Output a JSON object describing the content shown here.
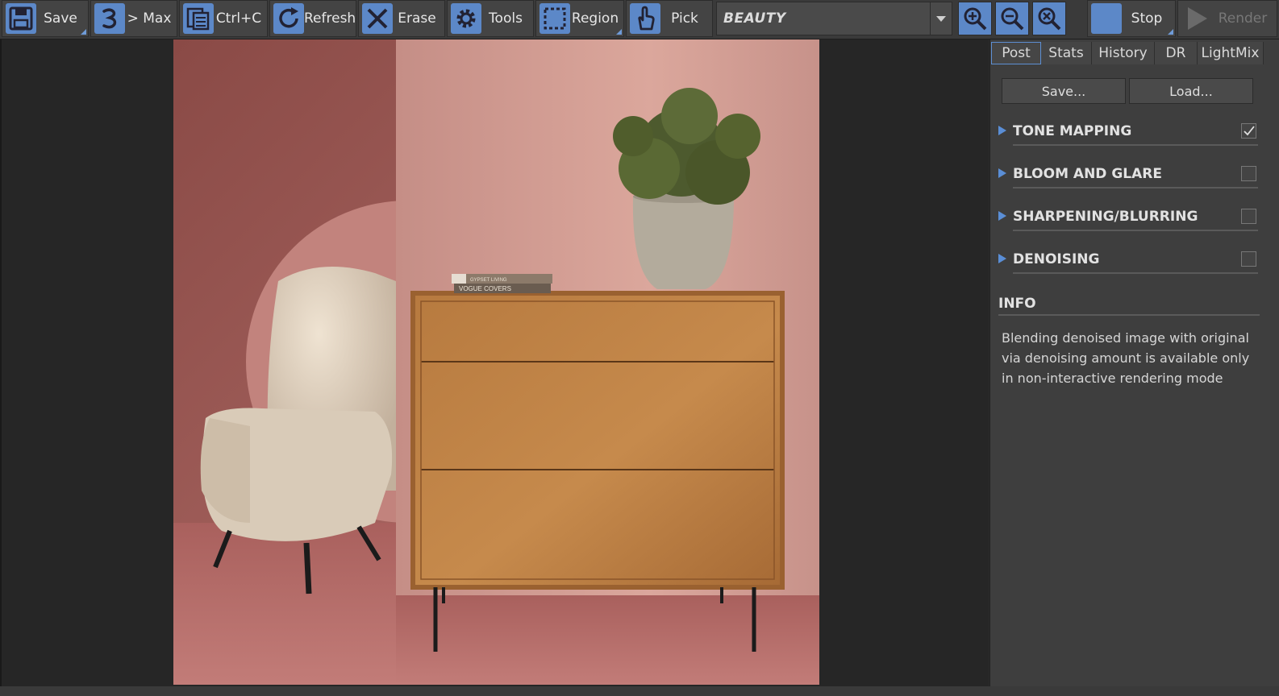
{
  "toolbar": {
    "save_label": "Save",
    "max_label": "> Max",
    "copy_label": "Ctrl+C",
    "refresh_label": "Refresh",
    "erase_label": "Erase",
    "tools_label": "Tools",
    "region_label": "Region",
    "pick_label": "Pick",
    "channel_value": "BEAUTY",
    "stop_label": "Stop",
    "render_label": "Render",
    "accent_color": "#5c88c8"
  },
  "render_scene": {
    "book_top_label": "GYPSET LIVING",
    "book_bottom_label": "VOGUE COVERS"
  },
  "panel": {
    "tabs": [
      {
        "label": "Post",
        "active": true
      },
      {
        "label": "Stats",
        "active": false
      },
      {
        "label": "History",
        "active": false
      },
      {
        "label": "DR",
        "active": false
      },
      {
        "label": "LightMix",
        "active": false
      }
    ],
    "save_button": "Save...",
    "load_button": "Load...",
    "sections": [
      {
        "title": "TONE MAPPING",
        "checked": true
      },
      {
        "title": "BLOOM AND GLARE",
        "checked": false
      },
      {
        "title": "SHARPENING/BLURRING",
        "checked": false
      },
      {
        "title": "DENOISING",
        "checked": false
      }
    ],
    "info_title": "INFO",
    "info_text": "Blending denoised image with original via denoising amount is available only in non-interactive rendering mode"
  }
}
